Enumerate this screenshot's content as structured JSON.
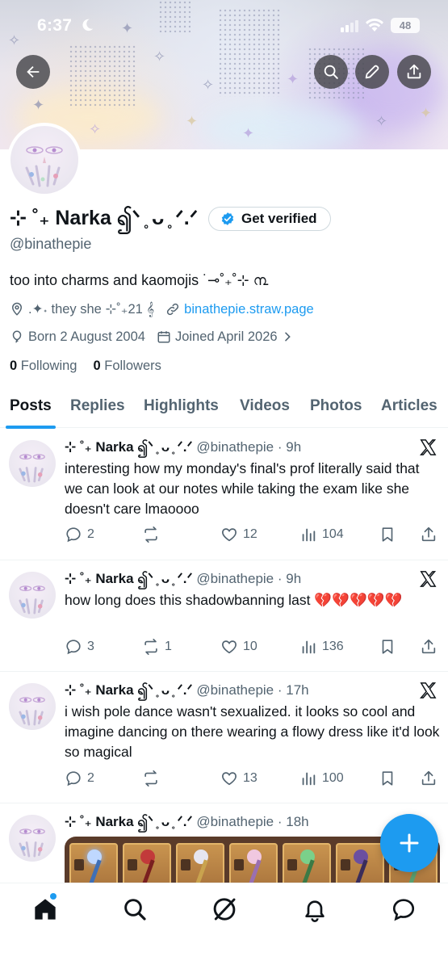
{
  "status_bar": {
    "time": "6:37",
    "battery": "48"
  },
  "profile": {
    "display_name": "⊹ ˚₊ Narka ၍ᐠ ̥ ᴗ ̥ ᐟ.ᐟ",
    "verify_label": "Get verified",
    "handle": "@binathepie",
    "bio": "too into charms and kaomojis ˙⊸˚₊˚⊹ ൩",
    "location": ".✦˖ they  she ⊹˚₊21 𝄞",
    "website": "binathepie.straw.page",
    "born": "Born 2 August 2004",
    "joined": "Joined April 2026",
    "following_count": "0",
    "following_label": "Following",
    "followers_count": "0",
    "followers_label": "Followers"
  },
  "tabs": [
    "Posts",
    "Replies",
    "Highlights",
    "Videos",
    "Photos",
    "Articles"
  ],
  "tweets": [
    {
      "name": "⊹ ˚₊ Narka ၍ᐠ ̥ ᴗ ̥ ᐟ.ᐟ",
      "handle_time": "@binathepie · 9h",
      "text": "interesting how my monday's final's prof literally said that we can look at our notes while taking the exam like she doesn't care lmaoooo",
      "replies": "2",
      "reposts": "",
      "likes": "12",
      "views": "104"
    },
    {
      "name": "⊹ ˚₊ Narka ၍ᐠ ̥ ᴗ ̥ ᐟ.ᐟ",
      "handle_time": "@binathepie · 9h",
      "text": "how long does this shadowbanning last 💔💔💔💔💔",
      "replies": "3",
      "reposts": "1",
      "likes": "10",
      "views": "136"
    },
    {
      "name": "⊹ ˚₊ Narka ၍ᐠ ̥ ᴗ ̥ ᐟ.ᐟ",
      "handle_time": "@binathepie · 17h",
      "text": "i wish pole dance wasn't sexualized. it looks so cool and imagine dancing on there wearing a flowy dress like it'd look so magical",
      "replies": "2",
      "reposts": "",
      "likes": "13",
      "views": "100"
    },
    {
      "name": "⊹ ˚₊ Narka ၍ᐠ ̥ ᴗ ̥ ᐟ.ᐟ",
      "handle_time": "@binathepie · 18h"
    }
  ],
  "icons": {
    "back": "arrow-left-icon",
    "search": "search-icon",
    "edit": "pencil-icon",
    "share": "share-icon",
    "verified": "verified-badge-icon",
    "x": "x-logo-icon",
    "compose": "plus-icon",
    "nav": [
      "home-icon",
      "search-icon",
      "grok-icon",
      "bell-icon",
      "messages-icon"
    ]
  },
  "colors": {
    "accent": "#1d9bf0",
    "text": "#0f1419",
    "muted": "#536471"
  }
}
